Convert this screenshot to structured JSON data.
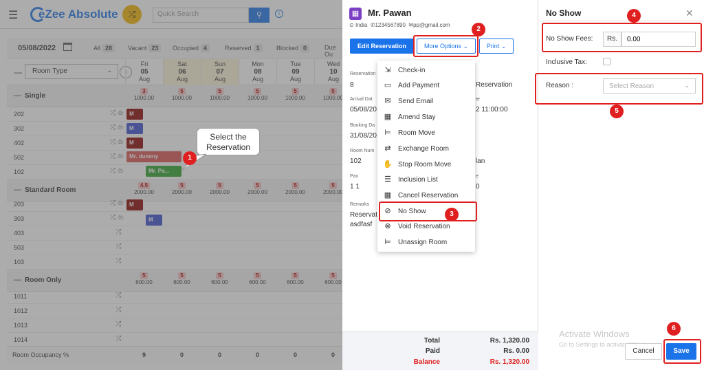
{
  "app": {
    "logo_text": "eZee Absolute",
    "search_placeholder": "Quick Search",
    "date": "05/08/2022",
    "filters": [
      {
        "label": "All",
        "count": "28"
      },
      {
        "label": "Vacant",
        "count": "23"
      },
      {
        "label": "Occupied",
        "count": "4"
      },
      {
        "label": "Reserved",
        "count": "1"
      },
      {
        "label": "Blocked",
        "count": "0"
      },
      {
        "label": "Due Ou",
        "count": ""
      }
    ],
    "room_type_select": "Room Type",
    "days": [
      {
        "dow": "Fri",
        "num": "05",
        "mon": "Aug"
      },
      {
        "dow": "Sat",
        "num": "06",
        "mon": "Aug"
      },
      {
        "dow": "Sun",
        "num": "07",
        "mon": "Aug"
      },
      {
        "dow": "Mon",
        "num": "08",
        "mon": "Aug"
      },
      {
        "dow": "Tue",
        "num": "09",
        "mon": "Aug"
      },
      {
        "dow": "Wed",
        "num": "10",
        "mon": "Aug"
      }
    ],
    "sections": [
      {
        "name": "Single",
        "avail": [
          "3",
          "5",
          "5",
          "5",
          "5",
          "5"
        ],
        "rate": [
          "1000.00",
          "1000.00",
          "1000.00",
          "1000.00",
          "1000.00",
          "1000.00"
        ],
        "rooms": [
          "202",
          "302",
          "402",
          "502",
          "102"
        ]
      },
      {
        "name": "Standard Room",
        "avail": [
          "4.5",
          "5",
          "5",
          "5",
          "5",
          "5"
        ],
        "rate": [
          "2000.00",
          "2000.00",
          "2000.00",
          "2000.00",
          "2000.00",
          "2000.00"
        ],
        "rooms": [
          "203",
          "303",
          "403",
          "503",
          "103"
        ]
      },
      {
        "name": "Room Only",
        "avail": [
          "5",
          "5",
          "5",
          "5",
          "5",
          "5"
        ],
        "rate": [
          "600.00",
          "600.00",
          "600.00",
          "600.00",
          "600.00",
          "600.00"
        ],
        "rooms": [
          "1011",
          "1012",
          "1013",
          "1014"
        ]
      }
    ],
    "bookings": {
      "mr_dummy": "Mr. dummy",
      "mr_pawan": "Mr. Pa...",
      "m1": "M",
      "m2": "M",
      "m3": "M",
      "m4": "M",
      "m5": "M"
    },
    "occupancy_label": "Room Occupancy %",
    "occupancy": [
      "9",
      "0",
      "0",
      "0",
      "0",
      "0"
    ],
    "callout": {
      "line1": "Select the",
      "line2": "Reservation"
    }
  },
  "reservation": {
    "guest_name": "Mr. Pawan",
    "country": "India",
    "phone": "1234567890",
    "email": "pp@gmail.com",
    "edit_btn": "Edit Reservation",
    "more_btn": "More Options",
    "print_btn": "Print",
    "fields": {
      "reservation_lbl": "Reservation",
      "reservation_val": "8",
      "reservation_right": "Reservation",
      "arrival_lbl": "Arrival Dat",
      "arrival_val": "05/08/20",
      "departure_lbl": "te",
      "departure_val": "2 11:00:00",
      "booking_lbl": "Booking Da",
      "booking_val": "31/08/20",
      "roomnum_lbl": "Room Num",
      "roomnum_val": "102",
      "rateplan_val": "lan",
      "pax_lbl": "Pax",
      "pax_val": "1   1",
      "pax_right_lbl": "e",
      "pax_right_val": "0",
      "remarks_lbl": "Remarks",
      "remarks_val1": "Reservati",
      "remarks_val2": "asdfasf"
    },
    "menu": [
      {
        "label": "Check-in",
        "icon": "check-in-icon",
        "glyph": "⇲"
      },
      {
        "label": "Add Payment",
        "icon": "payment-icon",
        "glyph": "▭"
      },
      {
        "label": "Send Email",
        "icon": "email-icon",
        "glyph": "✉"
      },
      {
        "label": "Amend Stay",
        "icon": "calendar-icon",
        "glyph": "▦"
      },
      {
        "label": "Room Move",
        "icon": "bed-icon",
        "glyph": "⊨"
      },
      {
        "label": "Exchange Room",
        "icon": "exchange-icon",
        "glyph": "⇄"
      },
      {
        "label": "Stop Room Move",
        "icon": "hand-icon",
        "glyph": "✋"
      },
      {
        "label": "Inclusion List",
        "icon": "list-icon",
        "glyph": "☰"
      },
      {
        "label": "Cancel Reservation",
        "icon": "cancel-calendar-icon",
        "glyph": "▦"
      },
      {
        "label": "No Show",
        "icon": "eye-slash-icon",
        "glyph": "⊘"
      },
      {
        "label": "Void Reservation",
        "icon": "void-icon",
        "glyph": "⊗"
      },
      {
        "label": "Unassign Room",
        "icon": "unassign-icon",
        "glyph": "⊨"
      }
    ],
    "totals": {
      "total_lbl": "Total",
      "total_val": "Rs. 1,320.00",
      "paid_lbl": "Paid",
      "paid_val": "Rs. 0.00",
      "balance_lbl": "Balance",
      "balance_val": "Rs. 1,320.00"
    }
  },
  "no_show": {
    "title": "No Show",
    "fees_lbl": "No Show Fees",
    "currency": "Rs.",
    "fees_val": "0.00",
    "inclusive_tax_lbl": "Inclusive Tax",
    "reason_lbl": "Reason",
    "reason_placeholder": "Select Reason",
    "cancel_btn": "Cancel",
    "save_btn": "Save",
    "watermark1": "Activate Windows",
    "watermark2": "Go to Settings to activate Windows."
  },
  "steps": [
    "1",
    "2",
    "3",
    "4",
    "5",
    "6"
  ],
  "colors": {
    "accent": "#1a73e8",
    "highlight": "#e02020",
    "booking_red": "#8b0000",
    "booking_green": "#2aa32a",
    "booking_blue": "#3a4fd0"
  }
}
